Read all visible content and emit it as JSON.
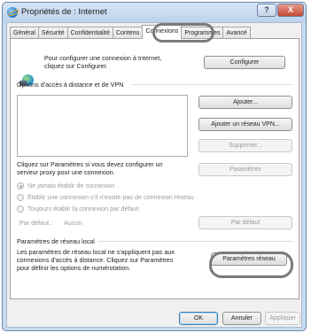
{
  "window": {
    "title": "Propriétés de : Internet",
    "help_label": "?",
    "close_label": "X"
  },
  "tabs": [
    {
      "label": "Général"
    },
    {
      "label": "Sécurité"
    },
    {
      "label": "Confidentialité"
    },
    {
      "label": "Contenu"
    },
    {
      "label": "Connexions"
    },
    {
      "label": "Programmes"
    },
    {
      "label": "Avancé"
    }
  ],
  "setup": {
    "text_line1": "Pour configurer une connexion à Internet,",
    "text_line2": "cliquez sur Configurer.",
    "button": "Configurer"
  },
  "dialup": {
    "group_title": "Options d'accès à distance et de VPN",
    "buttons": {
      "add": "Ajouter...",
      "add_vpn": "Ajouter un réseau VPN...",
      "remove": "Supprimer...",
      "settings": "Paramètres"
    },
    "proxy_line1": "Cliquez sur Paramètres si vous devez configurer un",
    "proxy_line2": "serveur proxy pour une connexion.",
    "radios": [
      {
        "label": "Ne jamais établir de connexion",
        "checked": true
      },
      {
        "label": "Établir une connexion s'il n'existe pas de connexion réseau",
        "checked": false
      },
      {
        "label": "Toujours établir la connexion par défaut",
        "checked": false
      }
    ],
    "default_label": "Par défaut :",
    "default_value": "Aucun",
    "default_button": "Par défaut"
  },
  "lan": {
    "group_title": "Paramètres de réseau local",
    "text_line1": "Les paramètres de réseau local ne s'appliquent pas aux",
    "text_line2": "connexions d'accès à distance. Cliquez sur Paramètres",
    "text_line3": "pour définir les options de numérotation.",
    "button": "Paramètres réseau"
  },
  "footer": {
    "ok": "OK",
    "cancel": "Annuler",
    "apply": "Appliquer"
  },
  "colors": {
    "frame": "#c7daf0",
    "close": "#c34a37",
    "annotation_circle": "#7a7a7a"
  }
}
